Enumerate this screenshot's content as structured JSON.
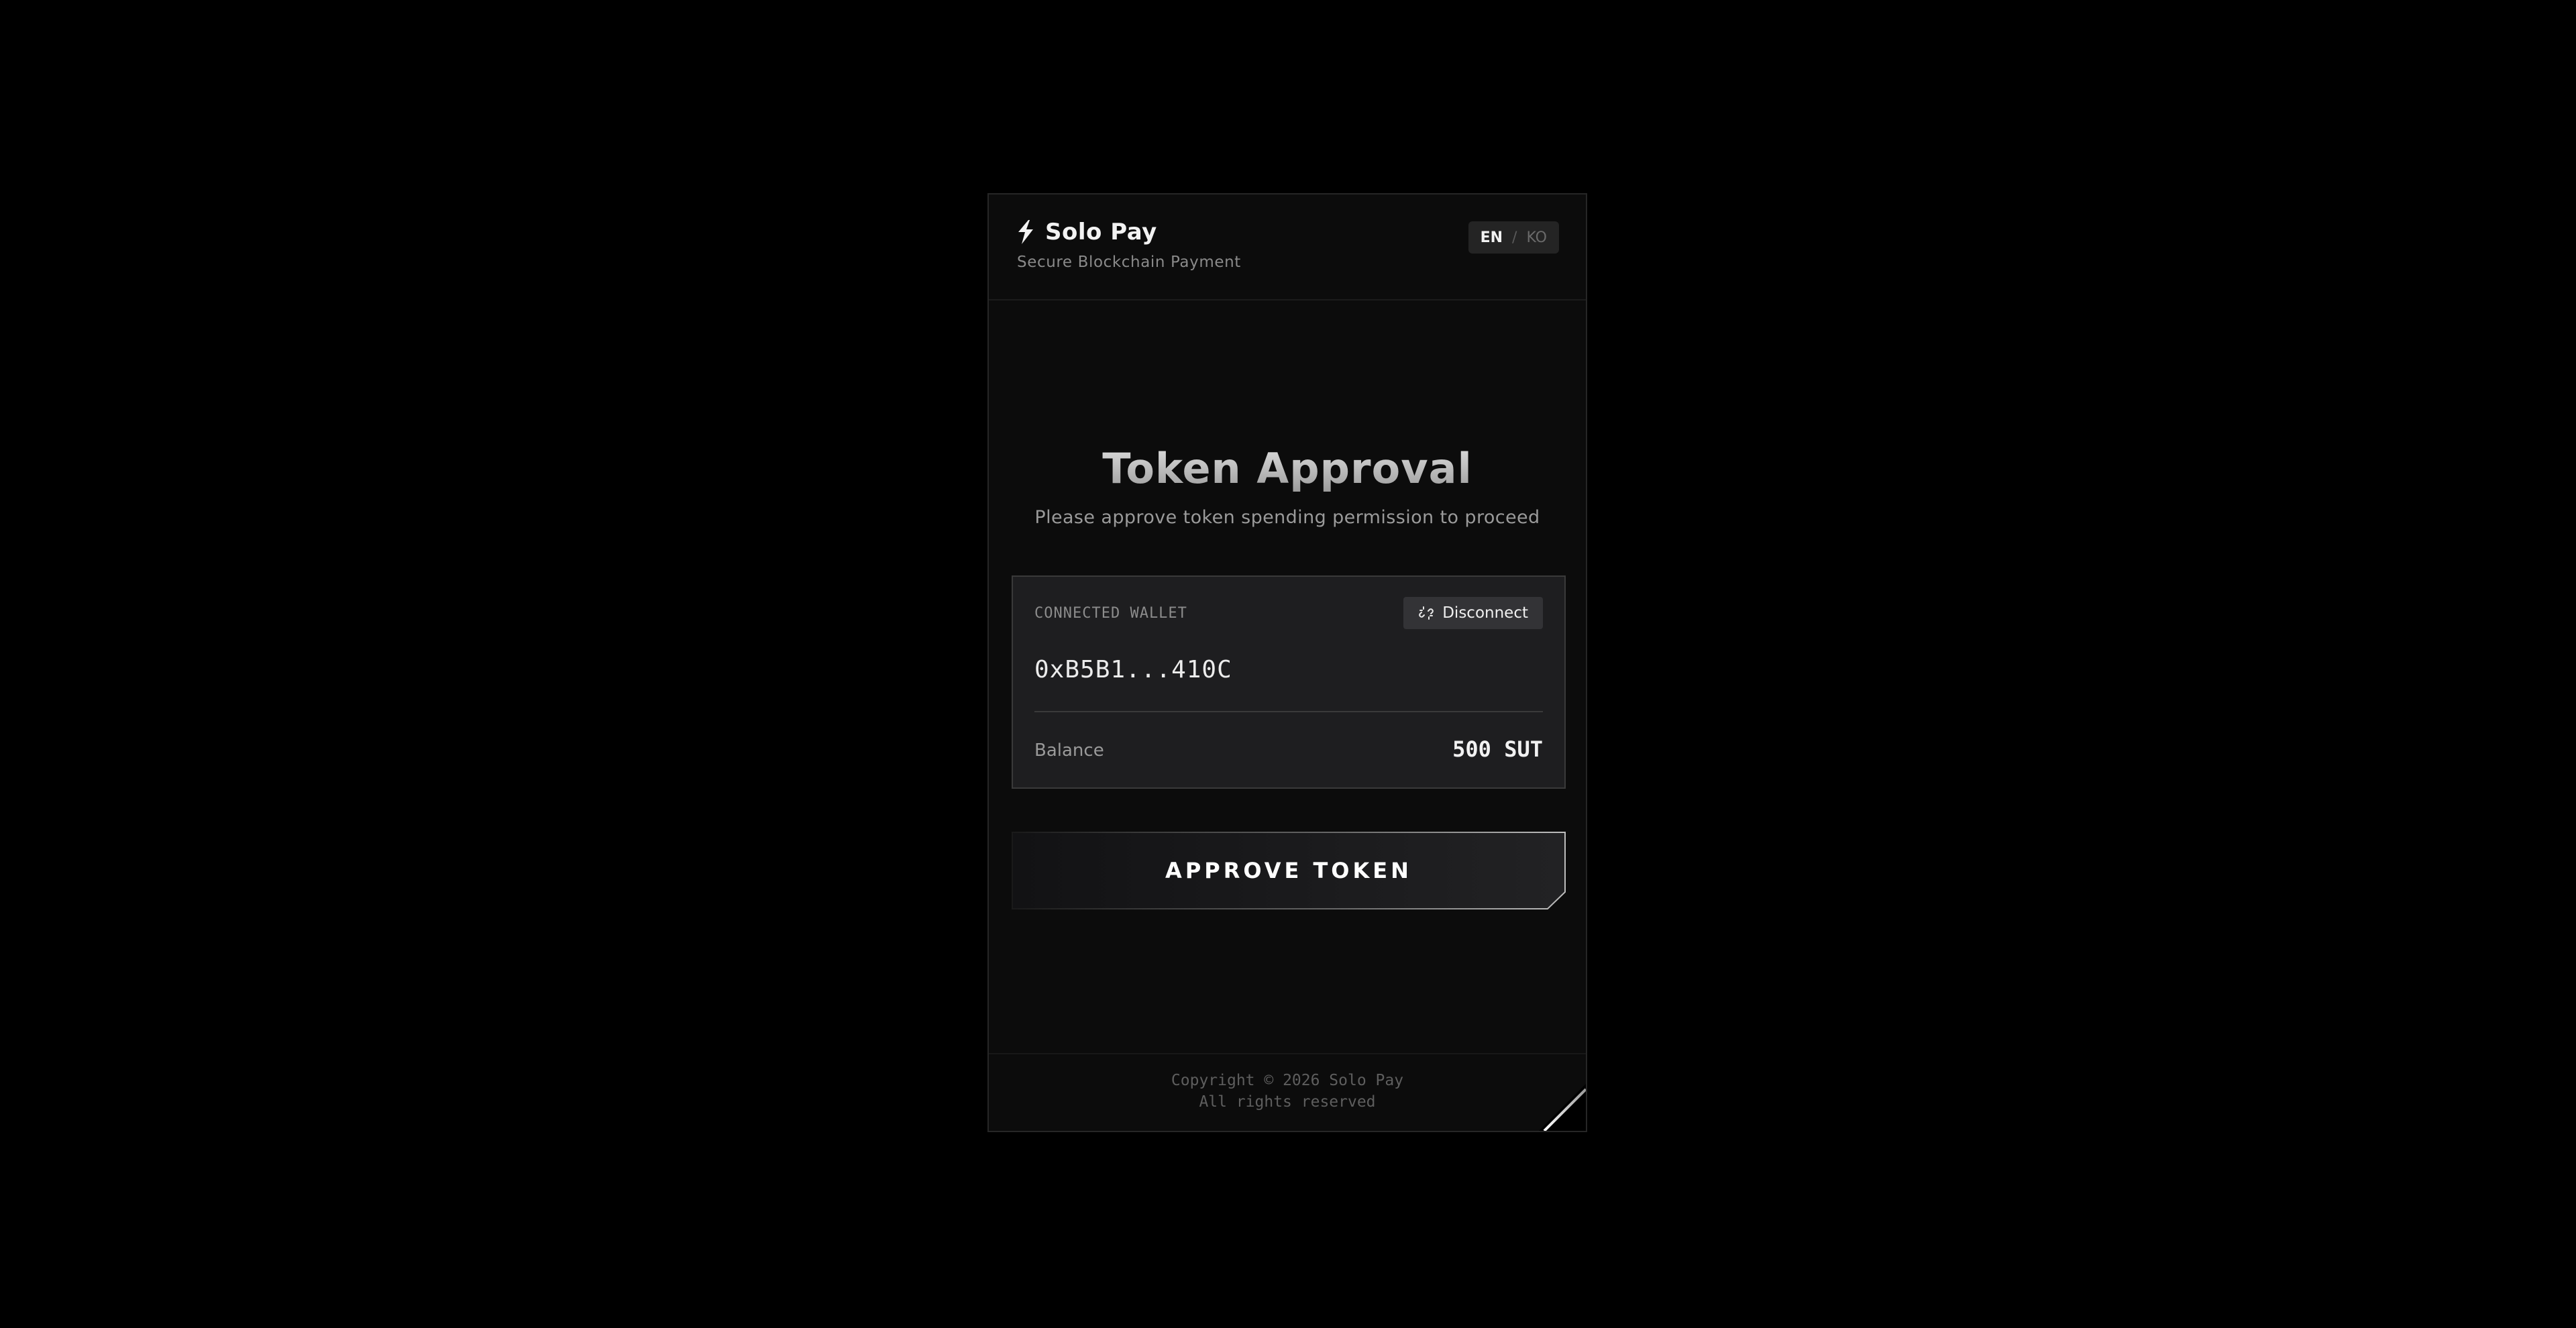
{
  "header": {
    "brand_name": "Solo Pay",
    "brand_subtitle": "Secure Blockchain Payment",
    "lang_en": "EN",
    "lang_sep": "/",
    "lang_ko": "KO"
  },
  "main": {
    "title": "Token Approval",
    "subtitle": "Please approve token spending permission to proceed"
  },
  "wallet": {
    "label": "CONNECTED WALLET",
    "disconnect_label": "Disconnect",
    "address": "0xB5B1...410C",
    "balance_label": "Balance",
    "balance_value": "500 SUT"
  },
  "actions": {
    "approve_label": "APPROVE TOKEN"
  },
  "footer": {
    "copyright": "Copyright © 2026 Solo Pay",
    "rights": "All rights reserved"
  },
  "icons": {
    "brand": "lightning-bolt-icon",
    "disconnect": "unlink-icon"
  },
  "colors": {
    "background": "#000000",
    "card": "#0c0c0c",
    "panel": "#1e1e20",
    "accent_text": "#f2f2f2"
  }
}
